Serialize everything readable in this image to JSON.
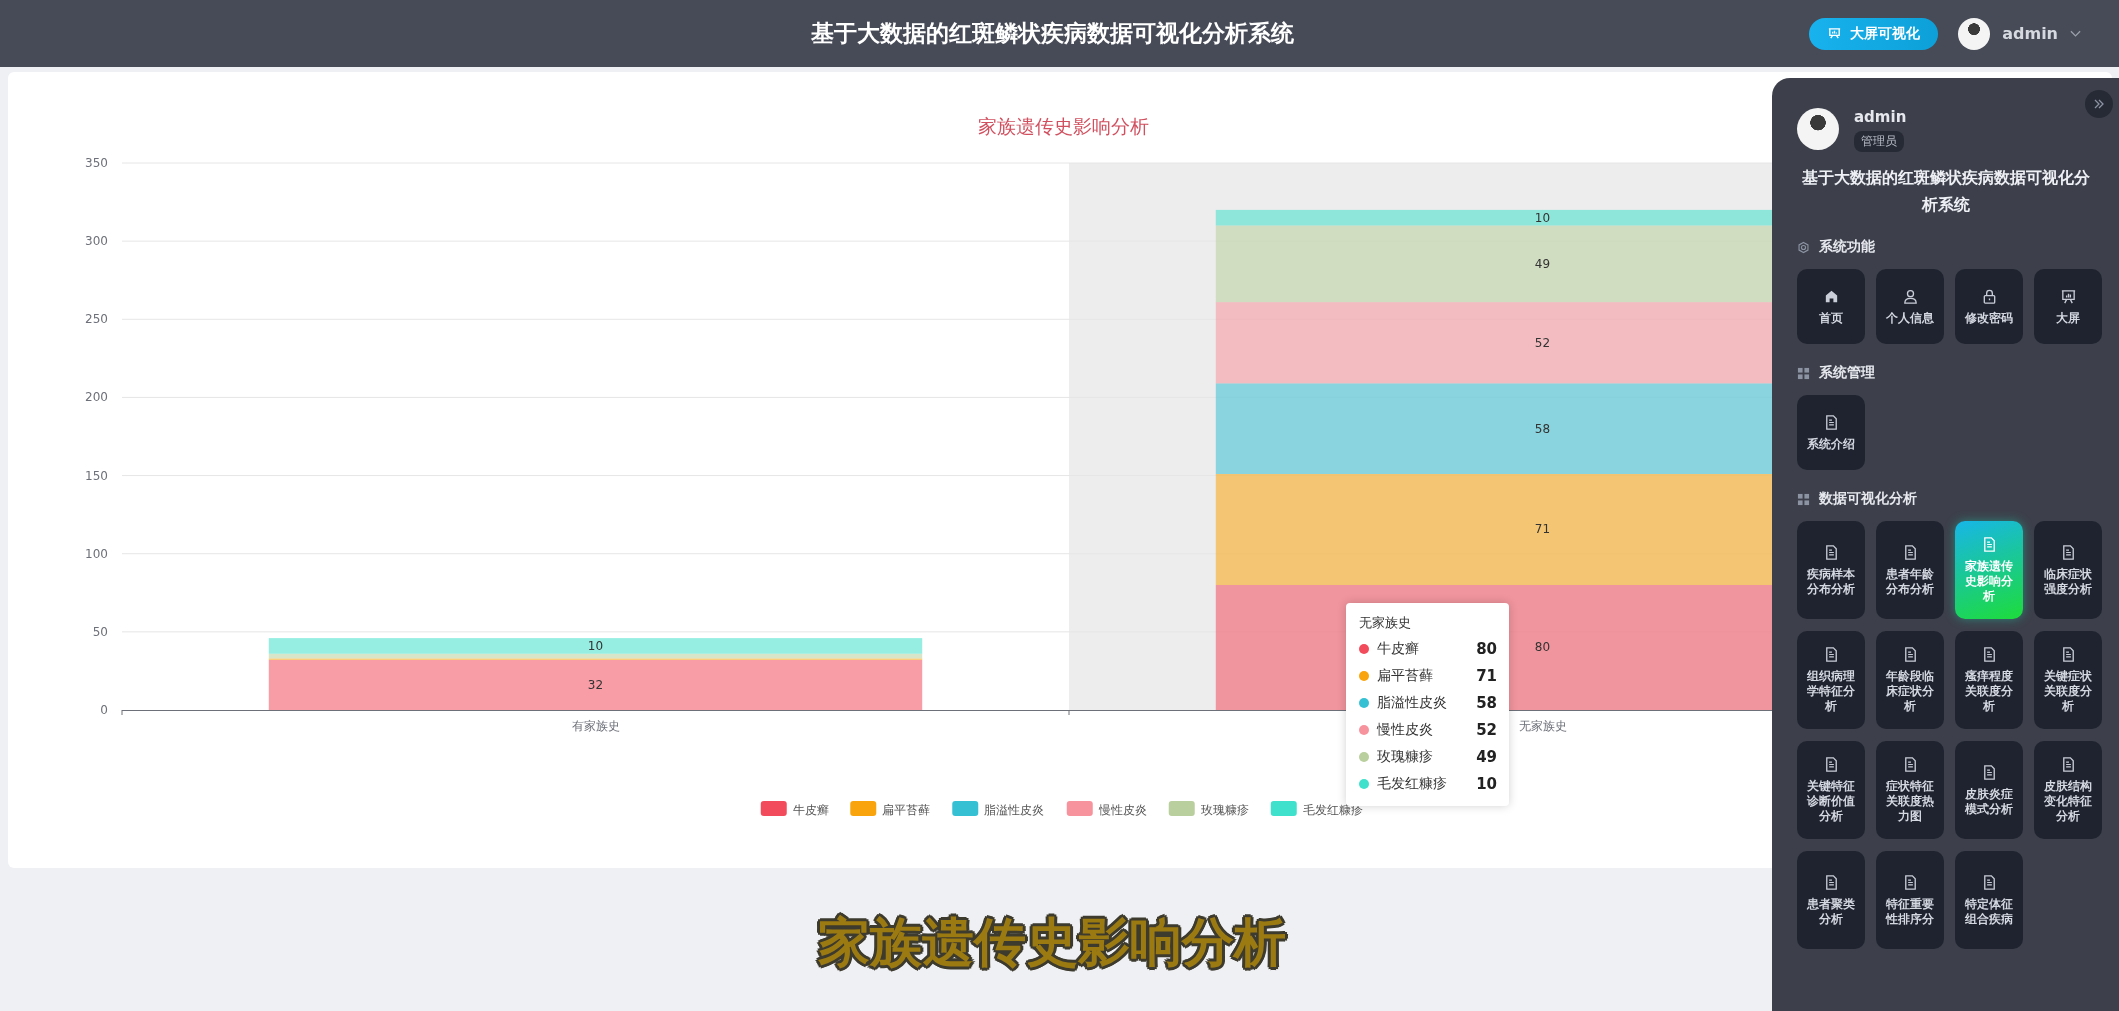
{
  "header": {
    "title": "基于大数据的红斑鳞状疾病数据可视化分析系统",
    "big_screen_button": "大屏可视化",
    "user": "admin"
  },
  "chart_panel": {
    "chart_data": {
      "type": "bar",
      "title": "家族遗传史影响分析",
      "categories": [
        "有家族史",
        "无家族史"
      ],
      "stacked": true,
      "ylim": [
        0,
        350
      ],
      "yticks": [
        0,
        50,
        100,
        150,
        200,
        250,
        300,
        350
      ],
      "grid": true,
      "legend": "bottom",
      "series": [
        {
          "name": "牛皮癣",
          "color": "#f24b5b",
          "values": [
            32,
            80
          ],
          "value_labels": [
            "32",
            "80"
          ]
        },
        {
          "name": "扁平苔藓",
          "color": "#f9a40c",
          "values": [
            1,
            71
          ],
          "value_labels": [
            null,
            "71"
          ]
        },
        {
          "name": "脂溢性皮炎",
          "color": "#36c0d3",
          "values": [
            0,
            58
          ],
          "value_labels": [
            null,
            "58"
          ]
        },
        {
          "name": "慢性皮炎",
          "color": "#f7939d",
          "values": [
            0,
            52
          ],
          "value_labels": [
            null,
            "52"
          ]
        },
        {
          "name": "玫瑰糠疹",
          "color": "#b9cf9d",
          "values": [
            3,
            49
          ],
          "value_labels": [
            null,
            "49"
          ]
        },
        {
          "name": "毛发红糠疹",
          "color": "#3fe0cc",
          "values": [
            10,
            10
          ],
          "value_labels": [
            "10",
            "10"
          ]
        }
      ]
    },
    "tooltip": {
      "title": "无家族史",
      "rows": [
        {
          "name": "牛皮癣",
          "value": "80",
          "color": "#f24b5b"
        },
        {
          "name": "扁平苔藓",
          "value": "71",
          "color": "#f9a40c"
        },
        {
          "name": "脂溢性皮炎",
          "value": "58",
          "color": "#36c0d3"
        },
        {
          "name": "慢性皮炎",
          "value": "52",
          "color": "#f7939d"
        },
        {
          "name": "玫瑰糠疹",
          "value": "49",
          "color": "#b9cf9d"
        },
        {
          "name": "毛发红糠疹",
          "value": "10",
          "color": "#3fe0cc"
        }
      ]
    }
  },
  "caption": "家族遗传史影响分析",
  "sidebar": {
    "user": {
      "name": "admin",
      "role": "管理员"
    },
    "title": "基于大数据的红斑鳞状疾病数据可视化分析系统",
    "sections": [
      {
        "title": "系统功能",
        "kind": "settings",
        "items": [
          {
            "label": "首页",
            "kind": "home",
            "selected": false
          },
          {
            "label": "个人信息",
            "kind": "profile",
            "selected": false
          },
          {
            "label": "修改密码",
            "kind": "password",
            "selected": false
          },
          {
            "label": "大屏",
            "kind": "screen",
            "selected": false
          }
        ]
      },
      {
        "title": "系统管理",
        "kind": "group",
        "items": [
          {
            "label": "系统介绍",
            "kind": "page",
            "selected": false
          }
        ]
      },
      {
        "title": "数据可视化分析",
        "kind": "group",
        "items": [
          {
            "label": "疾病样本分布分析",
            "kind": "page",
            "selected": false
          },
          {
            "label": "患者年龄分布分析",
            "kind": "page",
            "selected": false
          },
          {
            "label": "家族遗传史影响分析",
            "kind": "page",
            "selected": true
          },
          {
            "label": "临床症状强度分析",
            "kind": "page",
            "selected": false
          },
          {
            "label": "组织病理学特征分析",
            "kind": "page",
            "selected": false
          },
          {
            "label": "年龄段临床症状分析",
            "kind": "page",
            "selected": false
          },
          {
            "label": "瘙痒程度关联度分析",
            "kind": "page",
            "selected": false
          },
          {
            "label": "关键症状关联度分析",
            "kind": "page",
            "selected": false
          },
          {
            "label": "关键特征诊断价值分析",
            "kind": "page",
            "selected": false
          },
          {
            "label": "症状特征关联度热力图",
            "kind": "page",
            "selected": false
          },
          {
            "label": "皮肤炎症模式分析",
            "kind": "page",
            "selected": false
          },
          {
            "label": "皮肤结构变化特征分析",
            "kind": "page",
            "selected": false
          },
          {
            "label": "患者聚类分析",
            "kind": "page",
            "selected": false
          },
          {
            "label": "特征重要性排序分",
            "kind": "page",
            "selected": false
          },
          {
            "label": "特定体征组合疾病",
            "kind": "page",
            "selected": false
          }
        ]
      }
    ]
  }
}
